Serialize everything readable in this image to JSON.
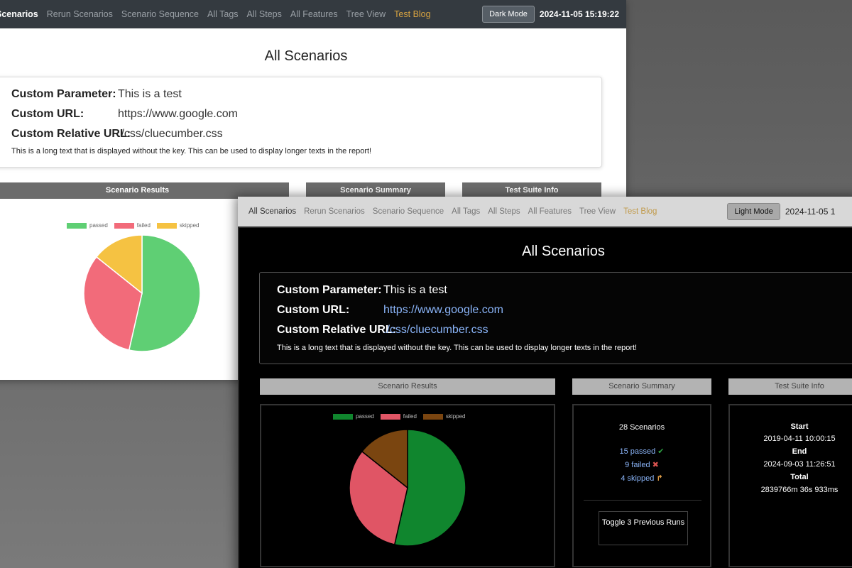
{
  "light": {
    "nav": {
      "items": [
        "Scenarios",
        "Rerun Scenarios",
        "Scenario Sequence",
        "All Tags",
        "All Steps",
        "All Features",
        "Tree View",
        "Test Blog"
      ],
      "mode_button": "Dark Mode",
      "timestamp": "2024-11-05 15:19:22"
    },
    "title": "All Scenarios",
    "params": [
      {
        "key": "Custom Parameter:",
        "value": "This is a test"
      },
      {
        "key": "Custom URL:",
        "value": "https://www.google.com"
      },
      {
        "key": "Custom Relative URL:",
        "value": "./css/cluecumber.css"
      }
    ],
    "long_text": "This is a long text that is displayed without the key. This can be used to display longer texts in the report!",
    "cards": [
      "Scenario Results",
      "Scenario Summary",
      "Test Suite Info"
    ],
    "legend": [
      "passed",
      "failed",
      "skipped"
    ],
    "colors": {
      "passed": "#5fcf74",
      "failed": "#f26b7a",
      "skipped": "#f5c242"
    }
  },
  "dark": {
    "nav": {
      "items": [
        "All Scenarios",
        "Rerun Scenarios",
        "Scenario Sequence",
        "All Tags",
        "All Steps",
        "All Features",
        "Tree View",
        "Test Blog"
      ],
      "mode_button": "Light Mode",
      "timestamp": "2024-11-05 1"
    },
    "title": "All Scenarios",
    "params": [
      {
        "key": "Custom Parameter:",
        "value": "This is a test"
      },
      {
        "key": "Custom URL:",
        "value": "https://www.google.com"
      },
      {
        "key": "Custom Relative URL:",
        "value": "./css/cluecumber.css"
      }
    ],
    "long_text": "This is a long text that is displayed without the key. This can be used to display longer texts in the report!",
    "cards": [
      "Scenario Results",
      "Scenario Summary",
      "Test Suite Info"
    ],
    "legend": [
      "passed",
      "failed",
      "skipped"
    ],
    "colors": {
      "passed": "#10862e",
      "failed": "#e05565",
      "skipped": "#7a4510"
    },
    "summary": {
      "total": "28 Scenarios",
      "passed": "15 passed",
      "failed": "9 failed",
      "skipped": "4 skipped",
      "toggle": "Toggle 3 Previous Runs"
    },
    "suite": {
      "start_label": "Start",
      "start": "2019-04-11 10:00:15",
      "end_label": "End",
      "end": "2024-09-03 11:26:51",
      "total_label": "Total",
      "total": "2839766m 36s 933ms"
    }
  },
  "chart_data": {
    "type": "pie",
    "categories": [
      "passed",
      "failed",
      "skipped"
    ],
    "values": [
      15,
      9,
      4
    ]
  }
}
